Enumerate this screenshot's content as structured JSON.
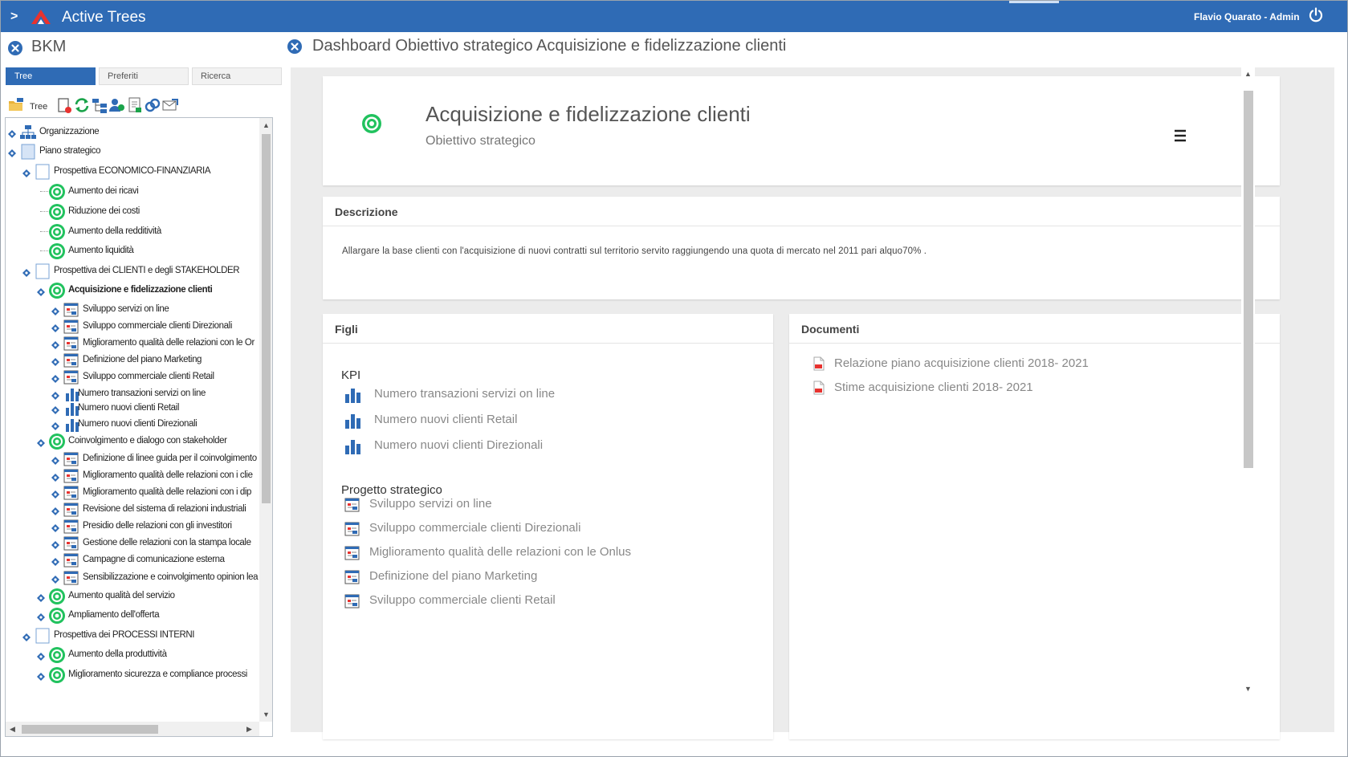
{
  "topbar": {
    "app_name": "Active Trees",
    "user": "Flavio Quarato - Admin",
    "chevron": ">"
  },
  "left": {
    "title": "BKM",
    "tabs": [
      "Tree",
      "Preferiti",
      "Ricerca"
    ],
    "toolbar_label": "Tree",
    "tree": [
      {
        "label": "Organizzazione",
        "icon": "org-chart-icon",
        "depth": 0,
        "expander": true
      },
      {
        "label": "Piano strategico",
        "icon": "folder-square-icon",
        "depth": 0,
        "expander": true
      },
      {
        "label": "Prospettiva ECONOMICO-FINANZIARIA",
        "icon": "square-icon",
        "depth": 1,
        "expander": true
      },
      {
        "label": "Aumento dei ricavi",
        "icon": "target-icon",
        "depth": 2
      },
      {
        "label": "Riduzione dei costi",
        "icon": "target-icon",
        "depth": 2
      },
      {
        "label": "Aumento della redditività",
        "icon": "target-icon",
        "depth": 2
      },
      {
        "label": "Aumento liquidità",
        "icon": "target-icon",
        "depth": 2
      },
      {
        "label": "Prospettiva dei CLIENTI e degli STAKEHOLDER",
        "icon": "square-icon",
        "depth": 1,
        "expander": true
      },
      {
        "label": "Acquisizione e fidelizzazione clienti",
        "icon": "target-icon",
        "depth": 2,
        "expander": true,
        "bold": true
      },
      {
        "label": "Sviluppo servizi on line",
        "icon": "project-icon",
        "depth": 3,
        "expander": true
      },
      {
        "label": "Sviluppo commerciale clienti Direzionali",
        "icon": "project-icon",
        "depth": 3,
        "expander": true
      },
      {
        "label": "Miglioramento qualità delle relazioni con le Or",
        "icon": "project-icon",
        "depth": 3,
        "expander": true
      },
      {
        "label": "Definizione del piano Marketing",
        "icon": "project-icon",
        "depth": 3,
        "expander": true
      },
      {
        "label": "Sviluppo commerciale clienti Retail",
        "icon": "project-icon",
        "depth": 3,
        "expander": true
      },
      {
        "label": "Numero transazioni servizi on line",
        "icon": "kpi-bar-icon",
        "depth": 3,
        "expander": true
      },
      {
        "label": "Numero nuovi clienti Retail",
        "icon": "kpi-bar-icon",
        "depth": 3,
        "expander": true
      },
      {
        "label": "Numero nuovi clienti Direzionali",
        "icon": "kpi-bar-icon",
        "depth": 3,
        "expander": true
      },
      {
        "label": "Coinvolgimento e dialogo con stakeholder",
        "icon": "target-icon",
        "depth": 2,
        "expander": true
      },
      {
        "label": "Definizione di linee guida per il coinvolgimento",
        "icon": "project-icon",
        "depth": 3,
        "expander": true
      },
      {
        "label": "Miglioramento qualità delle relazioni con i clie",
        "icon": "project-icon",
        "depth": 3,
        "expander": true
      },
      {
        "label": "Miglioramento qualità delle relazioni con i dip",
        "icon": "project-icon",
        "depth": 3,
        "expander": true
      },
      {
        "label": "Revisione del sistema di relazioni industriali",
        "icon": "project-icon",
        "depth": 3,
        "expander": true
      },
      {
        "label": "Presidio delle relazioni con gli investitori",
        "icon": "project-icon",
        "depth": 3,
        "expander": true
      },
      {
        "label": "Gestione delle relazioni con la stampa locale",
        "icon": "project-icon",
        "depth": 3,
        "expander": true
      },
      {
        "label": "Campagne di comunicazione esterna",
        "icon": "project-icon",
        "depth": 3,
        "expander": true
      },
      {
        "label": "Sensibilizzazione e coinvolgimento opinion lea",
        "icon": "project-icon",
        "depth": 3,
        "expander": true
      },
      {
        "label": "Aumento qualità del servizio",
        "icon": "target-icon",
        "depth": 2,
        "expander": true
      },
      {
        "label": "Ampliamento dell'offerta",
        "icon": "target-icon",
        "depth": 2,
        "expander": true
      },
      {
        "label": "Prospettiva dei PROCESSI INTERNI",
        "icon": "square-icon",
        "depth": 1,
        "expander": true
      },
      {
        "label": "Aumento della produttività",
        "icon": "target-icon",
        "depth": 2,
        "expander": true
      },
      {
        "label": "Miglioramento sicurezza e compliance processi",
        "icon": "target-icon",
        "depth": 2,
        "expander": true
      }
    ]
  },
  "main": {
    "title": "Dashboard Obiettivo strategico Acquisizione e fidelizzazione clienti",
    "hero": {
      "title": "Acquisizione e fidelizzazione clienti",
      "subtitle": "Obiettivo strategico"
    },
    "descrizione": {
      "title": "Descrizione",
      "text": "Allargare la base clienti con l'acquisizione di nuovi contratti sul territorio servito raggiungendo una quota di mercato nel 2011  pari alquo70% ."
    },
    "figli": {
      "title": "Figli",
      "kpi_label": "KPI",
      "kpi": [
        "Numero transazioni servizi on line",
        "Numero nuovi clienti Retail",
        "Numero nuovi clienti Direzionali"
      ],
      "progetto_label": "Progetto strategico",
      "progetti": [
        "Sviluppo servizi on line",
        "Sviluppo commerciale clienti Direzionali",
        "Miglioramento qualità delle relazioni con le Onlus",
        "Definizione del piano Marketing",
        "Sviluppo commerciale clienti Retail"
      ]
    },
    "documenti": {
      "title": "Documenti",
      "items": [
        "Relazione piano acquisizione clienti 2018- 2021",
        "Stime acquisizione clienti 2018- 2021"
      ]
    }
  },
  "colors": {
    "brand": "#2f6bb5",
    "target": "#21c25e",
    "kpi": "#2f6bb5"
  }
}
